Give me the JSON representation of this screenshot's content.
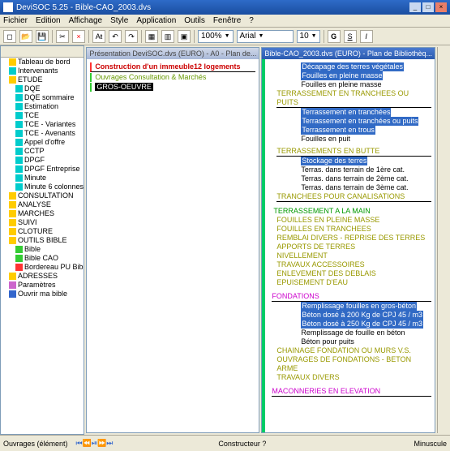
{
  "window": {
    "title": "DeviSOC 5.25 - Bible-CAO_2003.dvs"
  },
  "menu": {
    "m1": "Fichier",
    "m2": "Edition",
    "m3": "Affichage",
    "m4": "Style",
    "m5": "Application",
    "m6": "Outils",
    "m7": "Fenêtre",
    "m8": "?"
  },
  "toolbar": {
    "zoom": "100%",
    "font": "Arial",
    "size": "10",
    "g": "G",
    "s": "S",
    "i": "I"
  },
  "tree": {
    "t1": "Tableau de bord",
    "t2": "Intervenants",
    "t3": "ETUDE",
    "e1": "DQE",
    "e2": "DQE sommaire",
    "e3": "Estimation",
    "e4": "TCE",
    "e5": "TCE - Variantes",
    "e6": "TCE - Avenants",
    "e7": "Appel d'offre",
    "e8": "CCTP",
    "e9": "DPGF",
    "e10": "DPGF Entreprise",
    "e11": "Minute",
    "e12": "Minute 6 colonnes",
    "c1": "CONSULTATION",
    "c2": "ANALYSE",
    "c3": "MARCHES",
    "c4": "SUIVI",
    "c5": "CLOTURE",
    "c6": "OUTILS BIBLE",
    "b1": "Bible",
    "b2": "Bible CAO",
    "b3": "Bordereau PU Bible",
    "a1": "ADRESSES",
    "a2": "Paramètres",
    "a3": "Ouvrir ma bible"
  },
  "pane1": {
    "title": "Présentation DeviSOC.dvs (EURO) - A0 - Plan de...",
    "h1": "Construction d'un immeuble12 logements",
    "h2": "Ouvrages Consultation & Marchés",
    "item": "GROS-OEUVRE"
  },
  "pane2": {
    "title": "Bible-CAO_2003.dvs (EURO) - Plan de Bibliothèq...",
    "l1": "Décapage des terres végétales",
    "l2": "Fouilles en pleine masse",
    "l3": "Fouilles en pleine masse",
    "s1": "TERRASSEMENT EN TRANCHEES OU PUITS",
    "l4": "Terrassement en tranchées",
    "l5": "Terrassement en tranchées ou puits",
    "l6": "Terrassement en trous",
    "l7": "Fouilles en puit",
    "s2": "TERRASSEMENTS EN BUTTE",
    "l8": "Stockage des terres",
    "l9": "Terras. dans terrain de 1ère cat.",
    "l10": "Terras. dans terrain de 2ème cat.",
    "l11": "Terras. dans terrain de 3ème cat.",
    "s3": "TRANCHEES POUR CANALISATIONS",
    "s4": "TERRASSEMENT A LA MAIN",
    "s5": "FOUILLES EN PLEINE MASSE",
    "s6": "FOUILLES EN TRANCHEES",
    "s7": "REMBLAI DIVERS - REPRISE DES TERRES",
    "s8": "APPORTS DE TERRES",
    "s9": "NIVELLEMENT",
    "s10": "TRAVAUX ACCESSOIRES",
    "s11": "ENLEVEMENT DES DEBLAIS",
    "s12": "EPUISEMENT D'EAU",
    "s13": "FONDATIONS",
    "l12": "Remplissage fouilles en gros-béton",
    "l13": "Béton dosé à 200 Kg de CPJ 45 / m3",
    "l14": "Béton dosé à 250 Kg de CPJ 45 / m3",
    "l15": "Remplissage de fouille en béton",
    "l16": "Béton pour puits",
    "s14": "CHAINAGE FONDATION OU MURS V.S.",
    "s15": "OUVRAGES DE FONDATIONS - BETON ARME",
    "s16": "TRAVAUX DIVERS",
    "s17": "MACONNERIES EN ELEVATION"
  },
  "status": {
    "left": "Ouvrages (élément)",
    "mid": "Constructeur ?",
    "right": "Minuscule"
  }
}
